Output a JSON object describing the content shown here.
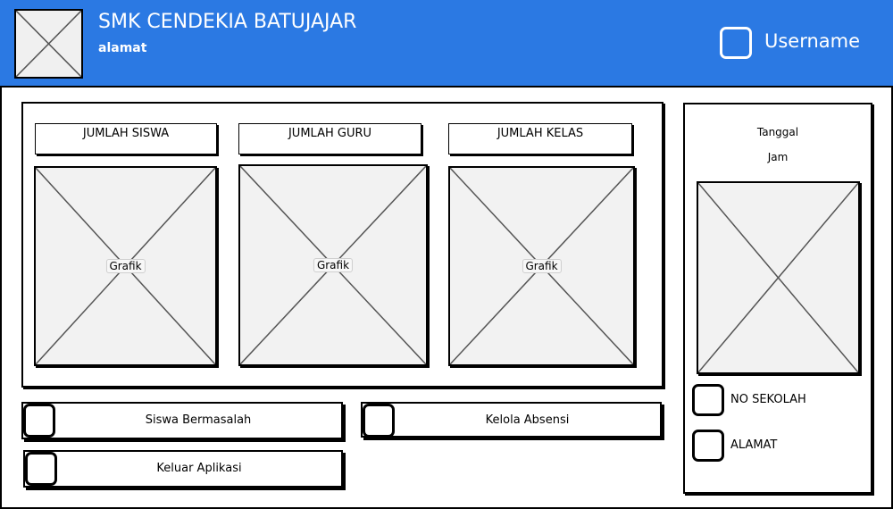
{
  "header": {
    "school_name": "SMK CENDEKIA BATUJAJAR",
    "address": "alamat",
    "username": "Username"
  },
  "stats": [
    {
      "label": "JUMLAH SISWA",
      "chart_label": "Grafik"
    },
    {
      "label": "JUMLAH GURU",
      "chart_label": "Grafik"
    },
    {
      "label": "JUMLAH KELAS",
      "chart_label": "Grafik"
    }
  ],
  "side_panel": {
    "date": "Tanggal",
    "time": "Jam",
    "info": [
      "NO SEKOLAH",
      "ALAMAT"
    ]
  },
  "menu": {
    "students_issue": "Siswa Bermasalah",
    "attendance": "Kelola Absensi",
    "logout": "Keluar Aplikasi"
  }
}
